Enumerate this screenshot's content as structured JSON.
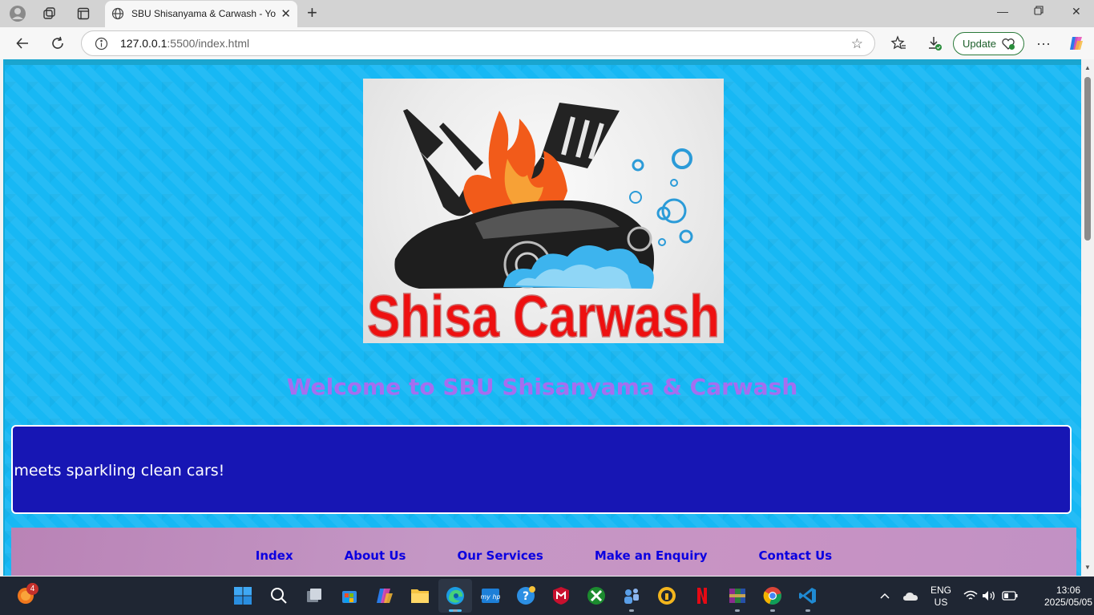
{
  "browser": {
    "tab_title": "SBU Shisanyama & Carwash - You",
    "url_host": "127.0.0.1",
    "url_path": ":5500/index.html",
    "update_label": "Update"
  },
  "page": {
    "logo_text": "Shisa Carwash",
    "welcome_heading": "Welcome to SBU Shisanyama & Carwash",
    "marquee_text": "ood meets sparkling clean cars!",
    "nav": [
      {
        "label": "Index"
      },
      {
        "label": "About Us"
      },
      {
        "label": "Our Services"
      },
      {
        "label": "Make an Enquiry"
      },
      {
        "label": "Contact Us"
      }
    ]
  },
  "taskbar": {
    "notification_count": "4",
    "lang_line1": "ENG",
    "lang_line2": "US",
    "time": "13:06",
    "date": "2025/05/05"
  },
  "colors": {
    "page_bg": "#17b8f4",
    "welcome_text": "#a56ef0",
    "marquee_bg": "#1716b4",
    "nav_bg": "#c497c5",
    "nav_link": "#0b00e0"
  }
}
